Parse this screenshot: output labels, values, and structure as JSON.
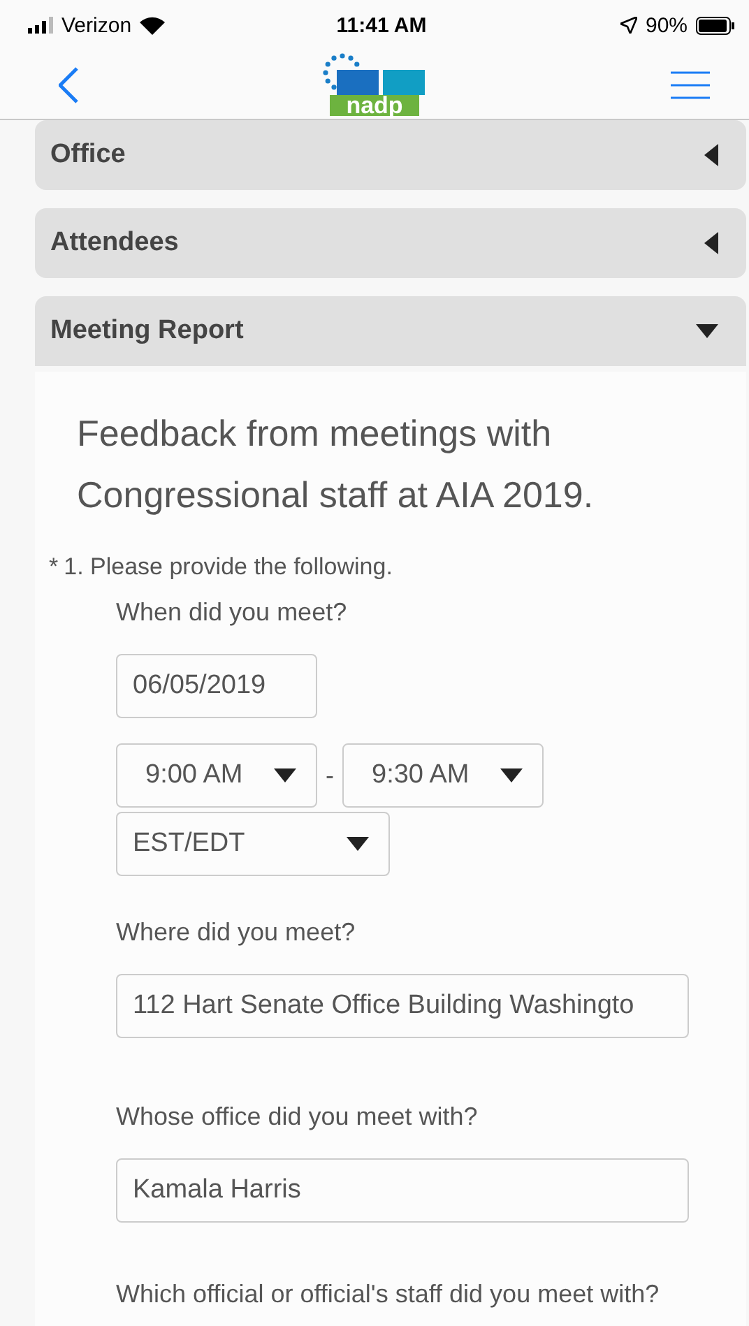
{
  "status_bar": {
    "carrier": "Verizon",
    "time": "11:41 AM",
    "battery": "90%"
  },
  "nav": {
    "logo_text": "nadp"
  },
  "sections": [
    {
      "title": "Office",
      "expanded": false
    },
    {
      "title": "Attendees",
      "expanded": false
    },
    {
      "title": "Meeting Report",
      "expanded": true
    }
  ],
  "report": {
    "heading": "Feedback from meetings with Congressional staff at AIA 2019.",
    "question": {
      "required_mark": "*",
      "label": "1. Please provide the following."
    },
    "when": {
      "label": "When did you meet?",
      "date": "06/05/2019",
      "start": "9:00 AM",
      "separator": "-",
      "end": "9:30 AM",
      "timezone": "EST/EDT"
    },
    "fields": [
      {
        "label": "Where did you meet?",
        "value": "112 Hart Senate Office Building Washingto"
      },
      {
        "label": "Whose office did you meet with?",
        "value": "Kamala Harris"
      }
    ],
    "next_label": "Which official or official's staff did you meet with?"
  }
}
